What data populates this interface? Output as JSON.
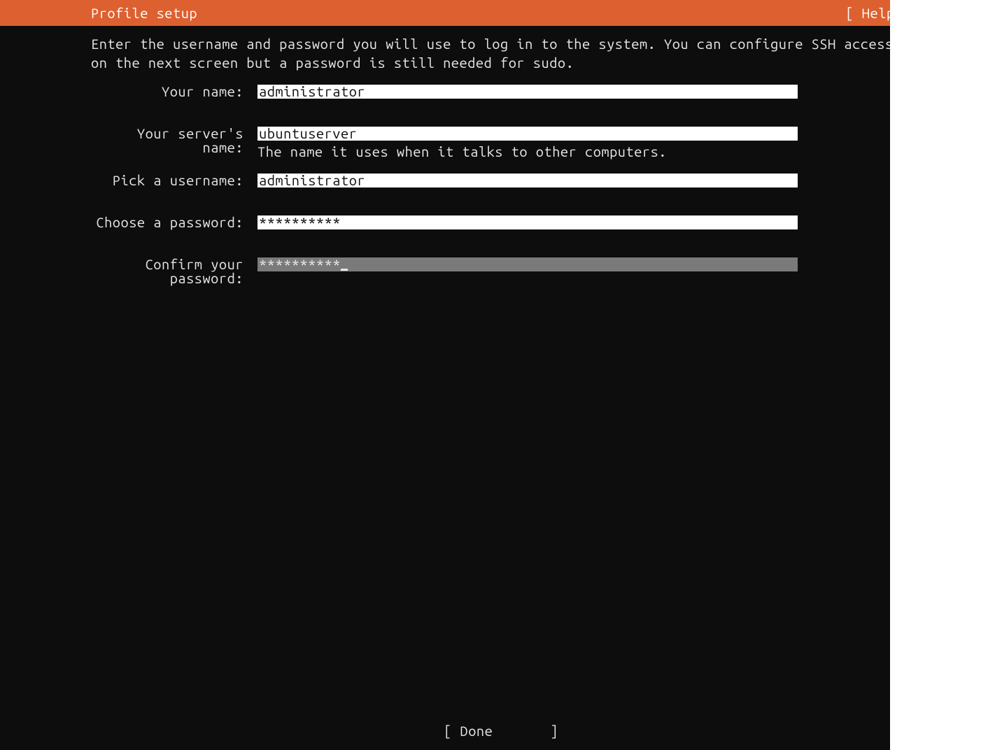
{
  "header": {
    "title": "Profile setup",
    "help_label": "[ Help ]"
  },
  "intro": "Enter the username and password you will use to log in to the system. You can configure SSH access on the next screen but a password is still needed for sudo.",
  "form": {
    "name": {
      "label": "Your name:",
      "value": "administrator"
    },
    "server": {
      "label": "Your server's name:",
      "value": "ubuntuserver",
      "hint": "The name it uses when it talks to other computers."
    },
    "username": {
      "label": "Pick a username:",
      "value": "administrator"
    },
    "password": {
      "label": "Choose a password:",
      "value": "**********"
    },
    "confirm": {
      "label": "Confirm your password:",
      "value": "**********"
    }
  },
  "footer": {
    "done_label": "[ Done       ]"
  }
}
